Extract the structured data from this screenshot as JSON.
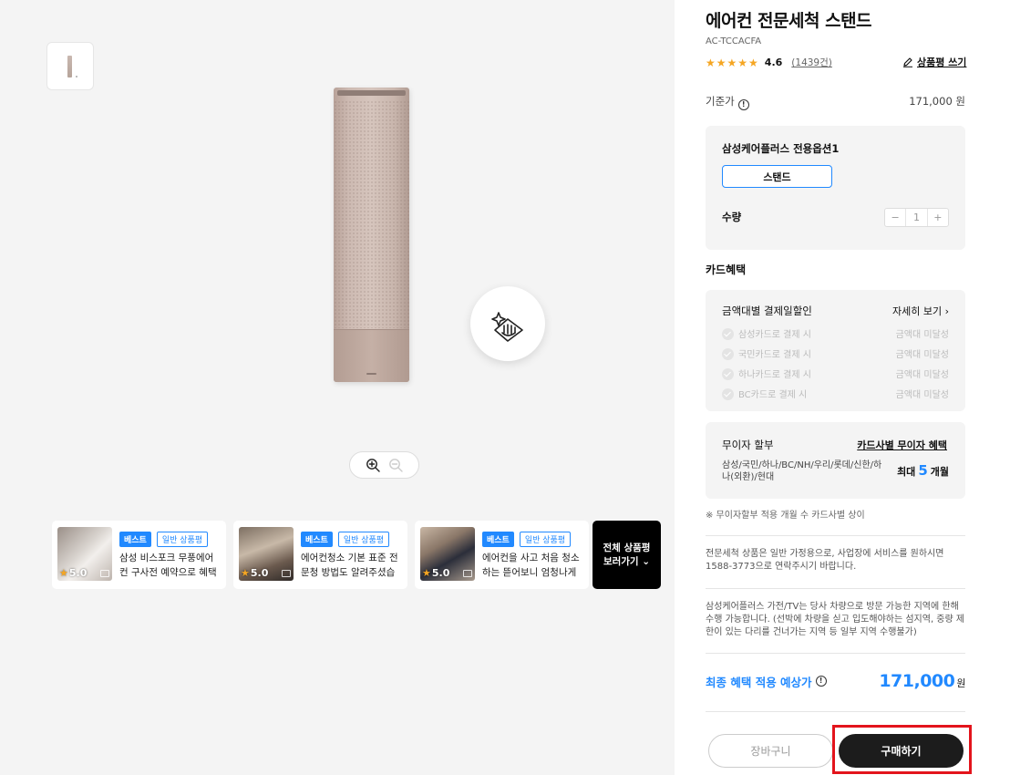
{
  "product": {
    "title": "에어컨 전문세척 스탠드",
    "model": "AC-TCCACFA",
    "stars": "★★★★★",
    "rating": "4.6",
    "review_count": "(1439건)",
    "write_review": "상품평 쓰기",
    "image_icon": "product-image"
  },
  "price": {
    "label": "기준가",
    "value": "171,000 원"
  },
  "option": {
    "title": "삼성케어플러스 전용옵션1",
    "selected": "스탠드",
    "qty_label": "수량",
    "qty_minus": "−",
    "qty_value": "1",
    "qty_plus": "+"
  },
  "card_benefit": {
    "section_label": "카드혜택",
    "title": "금액대별 결제일할인",
    "more": "자세히 보기",
    "rows": [
      {
        "name": "삼성카드로 결제 시",
        "status": "금액대 미달성"
      },
      {
        "name": "국민카드로 결제 시",
        "status": "금액대 미달성"
      },
      {
        "name": "하나카드로 결제 시",
        "status": "금액대 미달성"
      },
      {
        "name": "BC카드로 결제 시",
        "status": "금액대 미달성"
      }
    ]
  },
  "installment": {
    "title": "무이자 할부",
    "link": "카드사별 무이자 혜택",
    "cards": "삼성/국민/하나/BC/NH/우리/롯데/신한/하나(외환)/현대",
    "max_prefix": "최대",
    "max_num": "5",
    "max_suffix": "개월",
    "note": "※ 무이자할부 적용 개월 수 카드사별 상이"
  },
  "notices": {
    "n1": "전문세척 상품은 일반 가정용으로, 사업장에 서비스를 원하시면 1588-3773으로 연락주시기 바랍니다.",
    "n2": "삼성케어플러스 가전/TV는 당사 차량으로 방문 가능한 지역에 한해 수행 가능합니다. (선박에 차량을 싣고 입도해야하는 섬지역, 중량 제한이 있는 다리를 건너가는 지역 등 일부 지역 수행불가)"
  },
  "final": {
    "label": "최종 혜택 적용 예상가",
    "price": "171,000",
    "won": "원"
  },
  "actions": {
    "cart": "장바구니",
    "buy": "구매하기"
  },
  "reviews": [
    {
      "best": "베스트",
      "type": "일반 상품평",
      "rating": "5.0",
      "text": "삼성 비스포크 무풍에어컨 구사전 예약으로 혜택 받으..."
    },
    {
      "best": "베스트",
      "type": "일반 상품평",
      "rating": "5.0",
      "text": "에어컨청소 기본 표준 전문청 방법도 알려주셨습니다..."
    },
    {
      "best": "베스트",
      "type": "일반 상품평",
      "rating": "5.0",
      "text": "에어컨을 사고 처음 청소하는 뜯어보니 엄청나게 더러웠..."
    }
  ],
  "all_reviews": {
    "line1": "전체 상품평",
    "line2": "보러가기 ⌄"
  },
  "colors": {
    "accent": "#2189ff",
    "highlight": "#e3141c",
    "star": "#f5a623"
  }
}
